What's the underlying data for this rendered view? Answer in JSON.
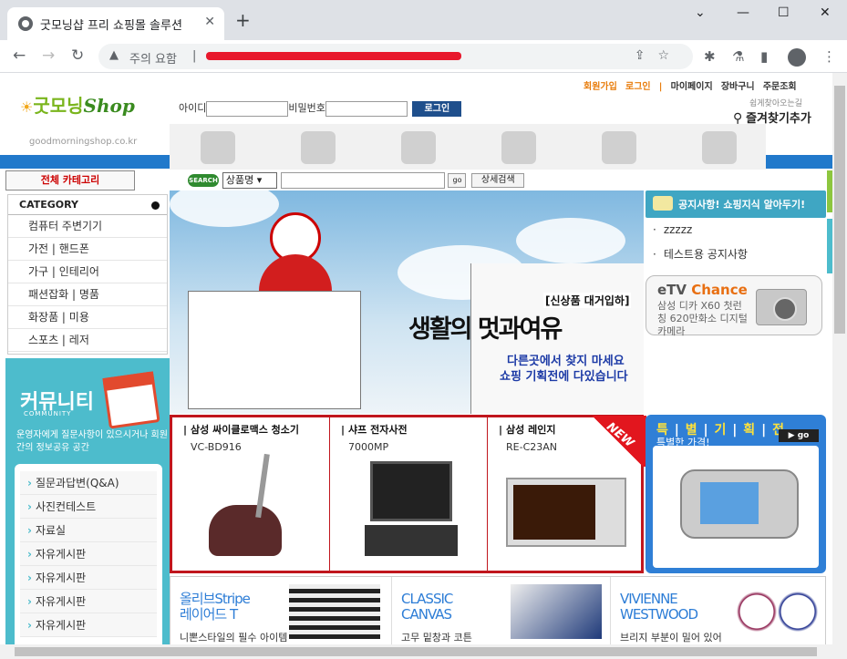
{
  "browser": {
    "tab_title": "굿모닝샵 프리 쇼핑몰 솔루션",
    "tab_close": "✕",
    "new_tab": "+",
    "security_warning": "주의 요함",
    "address_separator": "|"
  },
  "header": {
    "logo_ko": "굿모닝",
    "logo_shop": "Shop",
    "logo_url": "goodmorningshop.co.kr",
    "links": [
      {
        "label": "회원가입",
        "style": "orange"
      },
      {
        "label": "로그인",
        "style": "orange"
      },
      {
        "label": "|",
        "style": "orange"
      },
      {
        "label": "마이페이지",
        "style": "dark"
      },
      {
        "label": "장바구니",
        "style": "dark"
      },
      {
        "label": "주문조회",
        "style": "dark"
      }
    ],
    "login": {
      "id_label": "아이디",
      "pw_label": "비밀번호",
      "button": "로그인"
    },
    "favorite": {
      "small": "쉽게찾아오는길",
      "big": "즐겨찾기추가"
    }
  },
  "nav": {
    "all_category_button": "전체 카테고리",
    "search_badge": "SEARCH",
    "search_select": "상품명",
    "go_button": "go",
    "advanced_button": "상세검색"
  },
  "category": {
    "title": "CATEGORY",
    "items": [
      "컴퓨터 주변기기",
      "가전 | 핸드폰",
      "가구 | 인테리어",
      "패션잡화 | 명품",
      "화장품 | 미용",
      "스포츠 | 레저"
    ]
  },
  "community": {
    "title": "커뮤니티",
    "subtitle": "COMMUNITY",
    "description": "운영자에게 질문사항이 있으시거나 회원간의 정보공유 공간",
    "items": [
      "질문과답변(Q&A)",
      "사진컨테스트",
      "자료실",
      "자유게시판",
      "자유게시판",
      "자유게시판",
      "자유게시판"
    ]
  },
  "banner": {
    "tag": "[신상품 대거입하]",
    "headline": "생활의 멋과여유",
    "line1": "다른곳에서 찾지 마세요",
    "line2": "쇼핑 기획전에 다있습니다"
  },
  "notice": {
    "title": "공지사항! 쇼핑지식 알아두기!",
    "items": [
      "zzzzz",
      "테스트용 공지사항"
    ]
  },
  "etv": {
    "brand_plain": "eTV",
    "brand_accent": "Chance",
    "desc": "삼성 디카 X60 첫런칭 620만화소 디지털카메라"
  },
  "products": [
    {
      "name": "삼성 싸이클로맥스 청소기",
      "model": "VC-BD916"
    },
    {
      "name": "샤프 전자사전",
      "model": "7000MP"
    },
    {
      "name": "삼성 레인지",
      "model": "RE-C23AN"
    }
  ],
  "new_label": "NEW",
  "special": {
    "title_chars": [
      "특",
      "|",
      "별",
      "|",
      "기",
      "|",
      "획",
      "|",
      "전"
    ],
    "subtitle": "특별한 가격!",
    "go": "▶ go"
  },
  "bottom": [
    {
      "title": "올리브Stripe\n레이어드 T",
      "desc": "니뽄스타일의 필수 아이템"
    },
    {
      "title": "CLASSIC\nCANVAS",
      "desc": "고무 밑창과 코튼"
    },
    {
      "title": "VIVIENNE\nWESTWOOD",
      "desc": "브리지 부분이 밀어 있어"
    }
  ],
  "colors": {
    "accent_blue": "#2179cb",
    "red": "#c0161d",
    "teal": "#4dbccc"
  }
}
